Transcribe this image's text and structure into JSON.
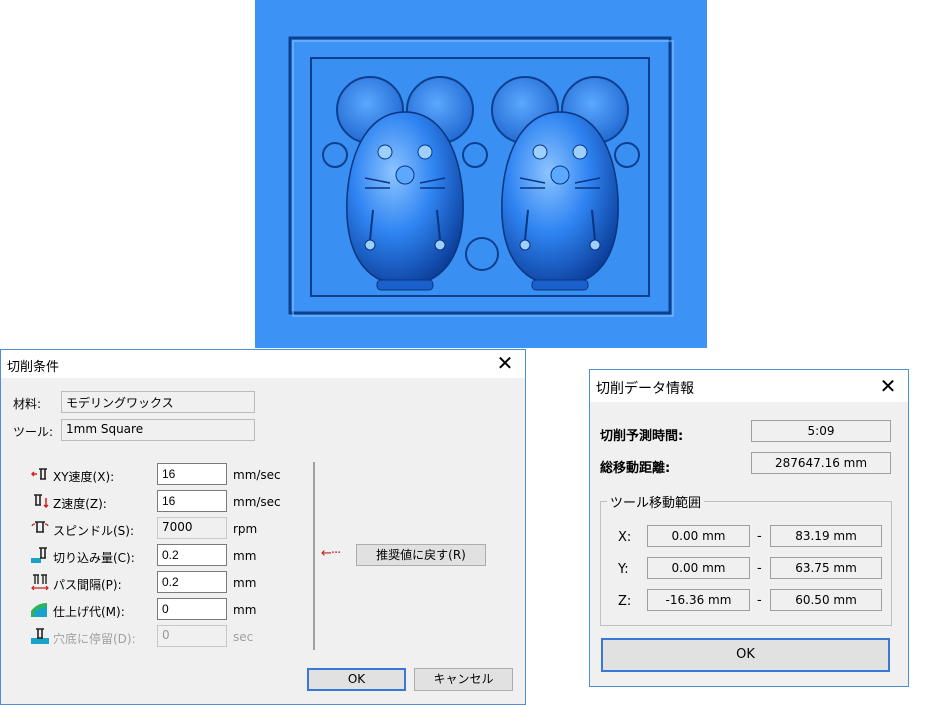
{
  "cutting_conditions": {
    "title": "切削条件",
    "material_label": "材料:",
    "material_value": "モデリングワックス",
    "tool_label": "ツール:",
    "tool_value": "1mm Square",
    "params": [
      {
        "label": "XY速度(X):",
        "value": "16",
        "unit": "mm/sec",
        "icon": "xy-speed-icon"
      },
      {
        "label": "Z速度(Z):",
        "value": "16",
        "unit": "mm/sec",
        "icon": "z-speed-icon"
      },
      {
        "label": "スピンドル(S):",
        "value": "7000",
        "unit": "rpm",
        "icon": "spindle-icon"
      },
      {
        "label": "切り込み量(C):",
        "value": "0.2",
        "unit": "mm",
        "icon": "cut-depth-icon"
      },
      {
        "label": "パス間隔(P):",
        "value": "0.2",
        "unit": "mm",
        "icon": "path-interval-icon"
      },
      {
        "label": "仕上げ代(M):",
        "value": "0",
        "unit": "mm",
        "icon": "finish-allowance-icon"
      },
      {
        "label": "穴底に停留(D):",
        "value": "0",
        "unit": "sec",
        "icon": "hole-dwell-icon"
      }
    ],
    "reset_label": "推奨値に戻す(R)",
    "ok_label": "OK",
    "cancel_label": "キャンセル"
  },
  "cutting_data": {
    "title": "切削データ情報",
    "time_label": "切削予測時間:",
    "time_value": "5:09",
    "distance_label": "総移動距離:",
    "distance_value": "287647.16 mm",
    "range_title": "ツール移動範囲",
    "ranges": [
      {
        "axis": "X:",
        "min": "0.00 mm",
        "max": "83.19 mm"
      },
      {
        "axis": "Y:",
        "min": "0.00 mm",
        "max": "63.75 mm"
      },
      {
        "axis": "Z:",
        "min": "-16.36 mm",
        "max": "60.50 mm"
      }
    ],
    "dash": "-",
    "ok_label": "OK"
  },
  "colors": {
    "preview_bg": "#3d93f5",
    "model": "#2a7ff0",
    "accent": "#3a78d8"
  },
  "icons": [
    "close-icon",
    "arrow-left-icon"
  ]
}
